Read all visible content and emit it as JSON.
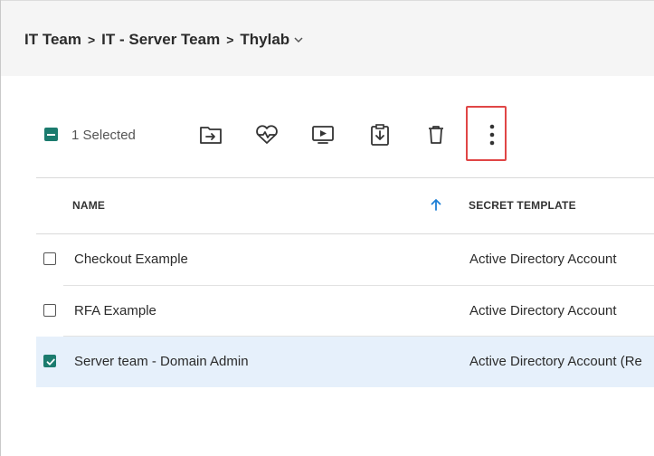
{
  "breadcrumb": {
    "items": [
      "IT Team",
      "IT - Server Team",
      "Thylab"
    ],
    "separator": ">"
  },
  "toolbar": {
    "selected_label": "1 Selected",
    "icons": [
      "move-to-folder-icon",
      "heartbeat-icon",
      "launch-session-icon",
      "export-icon",
      "delete-icon",
      "more-options-icon"
    ]
  },
  "table": {
    "columns": [
      "NAME",
      "SECRET TEMPLATE"
    ],
    "sort": {
      "column": "NAME",
      "direction": "ascending"
    },
    "rows": [
      {
        "name": "Checkout Example",
        "template": "Active Directory Account",
        "checked": false
      },
      {
        "name": "RFA Example",
        "template": "Active Directory Account",
        "checked": false
      },
      {
        "name": "Server team - Domain Admin",
        "template": "Active Directory Account (Re",
        "checked": true
      }
    ]
  },
  "colors": {
    "accent": "#1b7b6e",
    "selected_row": "#e6f0fb",
    "sort_arrow": "#1e7fd6",
    "highlight_box": "#e04646"
  }
}
